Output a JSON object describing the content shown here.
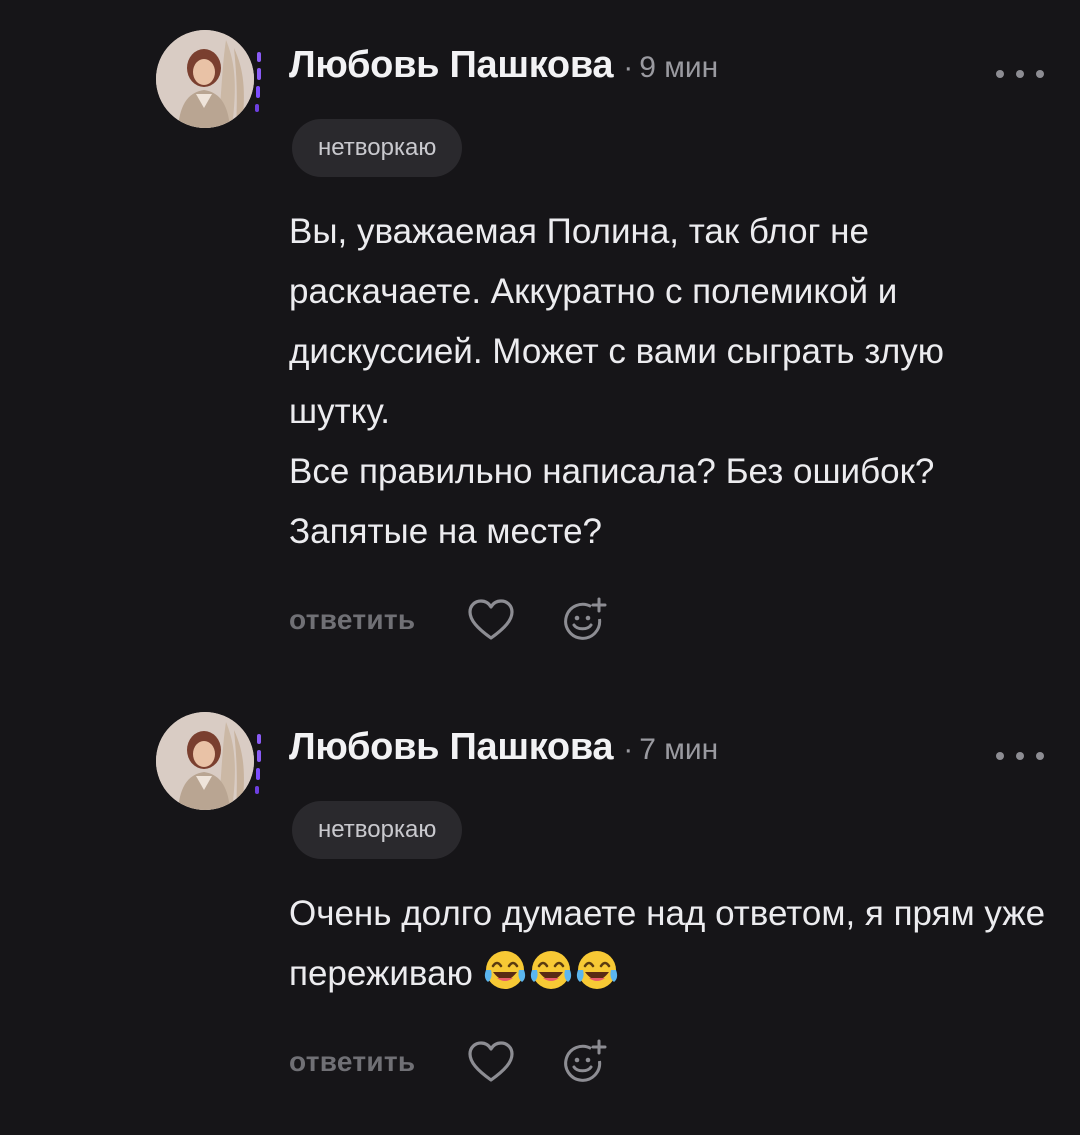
{
  "comments": [
    {
      "author": "Любовь Пашкова",
      "separator": "·",
      "time": "9 мин",
      "badge": "нетворкаю",
      "paragraphs": [
        "Вы, уважаемая Полина, так блог не раскачаете. Аккуратно с полемикой и дискуссией. Может с вами сыграть злую шутку.",
        "Все правильно написала? Без ошибок? Запятые на месте?"
      ],
      "reply_label": "ответить"
    },
    {
      "author": "Любовь Пашкова",
      "separator": "·",
      "time": "7 мин",
      "badge": "нетворкаю",
      "text": "Очень долго думаете над ответом, я прям уже переживаю",
      "emojis": [
        "face-with-tears-of-joy",
        "face-with-tears-of-joy",
        "face-with-tears-of-joy"
      ],
      "reply_label": "ответить"
    }
  ],
  "icons": {
    "more": "more-horizontal-icon",
    "like": "heart-outline-icon",
    "react": "add-reaction-icon"
  },
  "colors": {
    "background": "#161518",
    "accent": "#8b5cf6",
    "badge_bg": "#2a292d",
    "muted": "#707075"
  }
}
